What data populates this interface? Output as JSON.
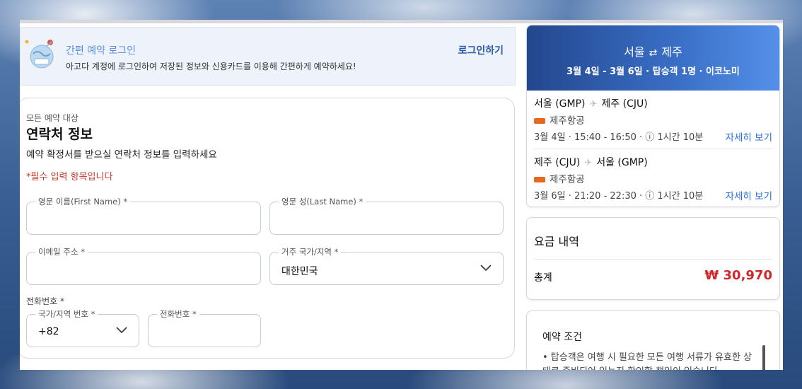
{
  "banner": {
    "title": "간편 예약 로그인",
    "subtitle": "아고다 계정에 로그인하여 저장된 정보와 신용카드를 이용해 간편하게 예약하세요!",
    "login_label": "로그인하기"
  },
  "contact": {
    "small_label": "모든 예약 대상",
    "title": "연락처 정보",
    "description": "예약 확정서를 받으실 연락처 정보를 입력하세요",
    "required_note": "*필수 입력 항목입니다",
    "first_name_label": "영문 이름(First Name) *",
    "first_name_value": "",
    "last_name_label": "영문 성(Last Name) *",
    "last_name_value": "",
    "email_label": "이메일 주소 *",
    "email_value": "",
    "country_label": "거주 국가/지역 *",
    "country_value": "대한민국",
    "phone_section_label": "전화번호 *",
    "country_code_label": "국가/지역 번호 *",
    "country_code_value": "+82",
    "phone_label": "전화번호 *",
    "phone_value": ""
  },
  "trip": {
    "origin": "서울",
    "destination": "제주",
    "route_icon": "swap-arrows-icon",
    "meta": "3월 4일 - 3월 6일 · 탑승객 1명 · 이코노미",
    "legs": [
      {
        "from": "서울 (GMP)",
        "to": "제주 (CJU)",
        "airline": "제주항공",
        "time": "3월 4일 · 15:40 - 16:50 · ⓘ 1시간 10분",
        "detail_label": "자세히 보기"
      },
      {
        "from": "제주 (CJU)",
        "to": "서울 (GMP)",
        "airline": "제주항공",
        "time": "3월 6일 · 21:20 - 22:30 · ⓘ 1시간 10분",
        "detail_label": "자세히 보기"
      }
    ]
  },
  "fare": {
    "title": "요금 내역",
    "total_label": "총계",
    "total_amount": "₩ 30,970"
  },
  "conditions": {
    "title": "예약 조건",
    "text": "• 탑승객은 여행 시 필요한 모든 여행 서류가 유효한 상태로 준비되어 있는지 확인할 책임이 있습니다"
  },
  "colors": {
    "accent": "#2a5aa8",
    "link": "#2a6fd6",
    "price": "#d0262c",
    "required": "#c0392b"
  }
}
